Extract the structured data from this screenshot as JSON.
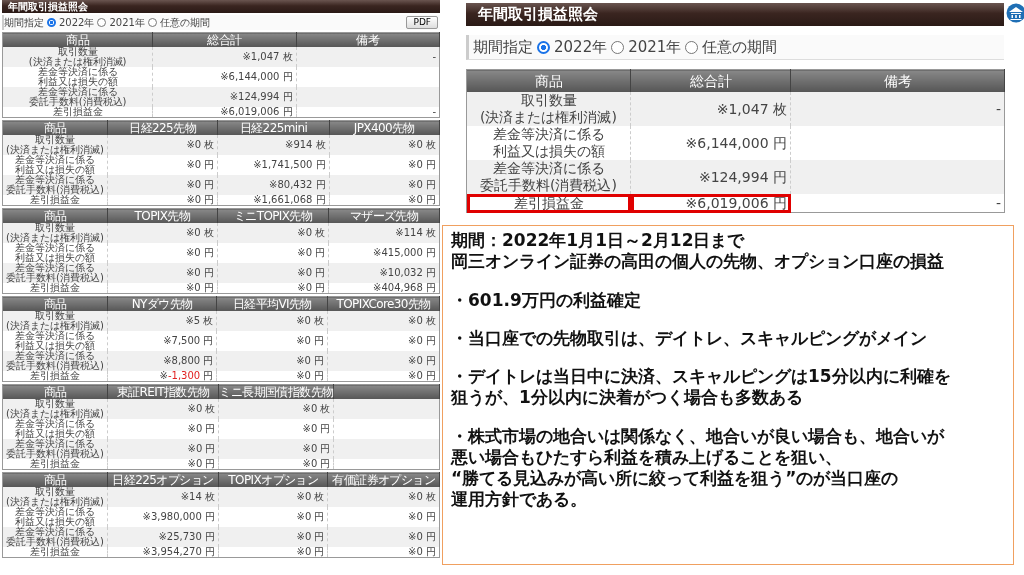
{
  "left_panel": {
    "title": "年間取引損益照会",
    "period_label": "期間指定",
    "period_options": [
      {
        "label": "2022年",
        "selected": true
      },
      {
        "label": "2021年",
        "selected": false
      },
      {
        "label": "任意の期間",
        "selected": false
      }
    ],
    "pdf_button": "PDF",
    "tables": [
      {
        "columns": [
          "商品",
          "総合計",
          "備考"
        ],
        "rows": [
          {
            "cells": [
              {
                "kind": "label",
                "lines": [
                  "取引数量",
                  "(決済または権利消滅)"
                ]
              },
              {
                "kind": "amount",
                "mark": "※",
                "amount": "1,047",
                "unit": "枚",
                "negative": false
              },
              {
                "kind": "text",
                "text": "-"
              }
            ]
          },
          {
            "cells": [
              {
                "kind": "label",
                "lines": [
                  "差金等決済に係る",
                  "利益又は損失の額"
                ]
              },
              {
                "kind": "amount",
                "mark": "※",
                "amount": "6,144,000",
                "unit": "円",
                "negative": false
              },
              null
            ]
          },
          {
            "cells": [
              {
                "kind": "label",
                "lines": [
                  "差金等決済に係る",
                  "委託手数料(消費税込)"
                ]
              },
              {
                "kind": "amount",
                "mark": "※",
                "amount": "124,994",
                "unit": "円",
                "negative": false
              },
              null
            ]
          },
          {
            "cells": [
              {
                "kind": "label",
                "lines": [
                  "差引損益金"
                ]
              },
              {
                "kind": "amount",
                "mark": "※",
                "amount": "6,019,006",
                "unit": "円",
                "negative": false
              },
              {
                "kind": "text",
                "text": "-"
              }
            ]
          }
        ]
      },
      {
        "columns": [
          "商品",
          "日経225先物",
          "日経225mini",
          "JPX400先物"
        ],
        "rows": [
          {
            "cells": [
              {
                "kind": "label",
                "lines": [
                  "取引数量",
                  "(決済または権利消滅)"
                ]
              },
              {
                "kind": "amount",
                "mark": "※",
                "amount": "0",
                "unit": "枚",
                "negative": false
              },
              {
                "kind": "amount",
                "mark": "※",
                "amount": "914",
                "unit": "枚",
                "negative": false
              },
              {
                "kind": "amount",
                "mark": "※",
                "amount": "0",
                "unit": "枚",
                "negative": false
              }
            ]
          },
          {
            "cells": [
              {
                "kind": "label",
                "lines": [
                  "差金等決済に係る",
                  "利益又は損失の額"
                ]
              },
              {
                "kind": "amount",
                "mark": "※",
                "amount": "0",
                "unit": "円",
                "negative": false
              },
              {
                "kind": "amount",
                "mark": "※",
                "amount": "1,741,500",
                "unit": "円",
                "negative": false
              },
              {
                "kind": "amount",
                "mark": "※",
                "amount": "0",
                "unit": "円",
                "negative": false
              }
            ]
          },
          {
            "cells": [
              {
                "kind": "label",
                "lines": [
                  "差金等決済に係る",
                  "委託手数料(消費税込)"
                ]
              },
              {
                "kind": "amount",
                "mark": "※",
                "amount": "0",
                "unit": "円",
                "negative": false
              },
              {
                "kind": "amount",
                "mark": "※",
                "amount": "80,432",
                "unit": "円",
                "negative": false
              },
              {
                "kind": "amount",
                "mark": "※",
                "amount": "0",
                "unit": "円",
                "negative": false
              }
            ]
          },
          {
            "cells": [
              {
                "kind": "label",
                "lines": [
                  "差引損益金"
                ]
              },
              {
                "kind": "amount",
                "mark": "※",
                "amount": "0",
                "unit": "円",
                "negative": false
              },
              {
                "kind": "amount",
                "mark": "※",
                "amount": "1,661,068",
                "unit": "円",
                "negative": false
              },
              {
                "kind": "amount",
                "mark": "※",
                "amount": "0",
                "unit": "円",
                "negative": false
              }
            ]
          }
        ]
      },
      {
        "columns": [
          "商品",
          "TOPIX先物",
          "ミニTOPIX先物",
          "マザーズ先物"
        ],
        "rows": [
          {
            "cells": [
              {
                "kind": "label",
                "lines": [
                  "取引数量",
                  "(決済または権利消滅)"
                ]
              },
              {
                "kind": "amount",
                "mark": "※",
                "amount": "0",
                "unit": "枚",
                "negative": false
              },
              {
                "kind": "amount",
                "mark": "※",
                "amount": "0",
                "unit": "枚",
                "negative": false
              },
              {
                "kind": "amount",
                "mark": "※",
                "amount": "114",
                "unit": "枚",
                "negative": false
              }
            ]
          },
          {
            "cells": [
              {
                "kind": "label",
                "lines": [
                  "差金等決済に係る",
                  "利益又は損失の額"
                ]
              },
              {
                "kind": "amount",
                "mark": "※",
                "amount": "0",
                "unit": "円",
                "negative": false
              },
              {
                "kind": "amount",
                "mark": "※",
                "amount": "0",
                "unit": "円",
                "negative": false
              },
              {
                "kind": "amount",
                "mark": "※",
                "amount": "415,000",
                "unit": "円",
                "negative": false
              }
            ]
          },
          {
            "cells": [
              {
                "kind": "label",
                "lines": [
                  "差金等決済に係る",
                  "委託手数料(消費税込)"
                ]
              },
              {
                "kind": "amount",
                "mark": "※",
                "amount": "0",
                "unit": "円",
                "negative": false
              },
              {
                "kind": "amount",
                "mark": "※",
                "amount": "0",
                "unit": "円",
                "negative": false
              },
              {
                "kind": "amount",
                "mark": "※",
                "amount": "10,032",
                "unit": "円",
                "negative": false
              }
            ]
          },
          {
            "cells": [
              {
                "kind": "label",
                "lines": [
                  "差引損益金"
                ]
              },
              {
                "kind": "amount",
                "mark": "※",
                "amount": "0",
                "unit": "円",
                "negative": false
              },
              {
                "kind": "amount",
                "mark": "※",
                "amount": "0",
                "unit": "円",
                "negative": false
              },
              {
                "kind": "amount",
                "mark": "※",
                "amount": "404,968",
                "unit": "円",
                "negative": false
              }
            ]
          }
        ]
      },
      {
        "columns": [
          "商品",
          "NYダウ先物",
          "日経平均VI先物",
          "TOPIXCore30先物"
        ],
        "rows": [
          {
            "cells": [
              {
                "kind": "label",
                "lines": [
                  "取引数量",
                  "(決済または権利消滅)"
                ]
              },
              {
                "kind": "amount",
                "mark": "※",
                "amount": "5",
                "unit": "枚",
                "negative": false
              },
              {
                "kind": "amount",
                "mark": "※",
                "amount": "0",
                "unit": "枚",
                "negative": false
              },
              {
                "kind": "amount",
                "mark": "※",
                "amount": "0",
                "unit": "枚",
                "negative": false
              }
            ]
          },
          {
            "cells": [
              {
                "kind": "label",
                "lines": [
                  "差金等決済に係る",
                  "利益又は損失の額"
                ]
              },
              {
                "kind": "amount",
                "mark": "※",
                "amount": "7,500",
                "unit": "円",
                "negative": false
              },
              {
                "kind": "amount",
                "mark": "※",
                "amount": "0",
                "unit": "円",
                "negative": false
              },
              {
                "kind": "amount",
                "mark": "※",
                "amount": "0",
                "unit": "円",
                "negative": false
              }
            ]
          },
          {
            "cells": [
              {
                "kind": "label",
                "lines": [
                  "差金等決済に係る",
                  "委託手数料(消費税込)"
                ]
              },
              {
                "kind": "amount",
                "mark": "※",
                "amount": "8,800",
                "unit": "円",
                "negative": false
              },
              {
                "kind": "amount",
                "mark": "※",
                "amount": "0",
                "unit": "円",
                "negative": false
              },
              {
                "kind": "amount",
                "mark": "※",
                "amount": "0",
                "unit": "円",
                "negative": false
              }
            ]
          },
          {
            "cells": [
              {
                "kind": "label",
                "lines": [
                  "差引損益金"
                ]
              },
              {
                "kind": "amount",
                "mark": "※",
                "amount": "-1,300",
                "unit": "円",
                "negative": true
              },
              {
                "kind": "amount",
                "mark": "※",
                "amount": "0",
                "unit": "円",
                "negative": false
              },
              {
                "kind": "amount",
                "mark": "※",
                "amount": "0",
                "unit": "円",
                "negative": false
              }
            ]
          }
        ]
      },
      {
        "columns": [
          "商品",
          "東証REIT指数先物",
          "ミニ長期国債指数先物",
          null
        ],
        "rows": [
          {
            "cells": [
              {
                "kind": "label",
                "lines": [
                  "取引数量",
                  "(決済または権利消滅)"
                ]
              },
              {
                "kind": "amount",
                "mark": "※",
                "amount": "0",
                "unit": "枚",
                "negative": false
              },
              {
                "kind": "amount",
                "mark": "※",
                "amount": "0",
                "unit": "枚",
                "negative": false
              },
              null
            ]
          },
          {
            "cells": [
              {
                "kind": "label",
                "lines": [
                  "差金等決済に係る",
                  "利益又は損失の額"
                ]
              },
              {
                "kind": "amount",
                "mark": "※",
                "amount": "0",
                "unit": "円",
                "negative": false
              },
              {
                "kind": "amount",
                "mark": "※",
                "amount": "0",
                "unit": "円",
                "negative": false
              },
              null
            ]
          },
          {
            "cells": [
              {
                "kind": "label",
                "lines": [
                  "差金等決済に係る",
                  "委託手数料(消費税込)"
                ]
              },
              {
                "kind": "amount",
                "mark": "※",
                "amount": "0",
                "unit": "円",
                "negative": false
              },
              {
                "kind": "amount",
                "mark": "※",
                "amount": "0",
                "unit": "円",
                "negative": false
              },
              null
            ]
          },
          {
            "cells": [
              {
                "kind": "label",
                "lines": [
                  "差引損益金"
                ]
              },
              {
                "kind": "amount",
                "mark": "※",
                "amount": "0",
                "unit": "円",
                "negative": false
              },
              {
                "kind": "amount",
                "mark": "※",
                "amount": "0",
                "unit": "円",
                "negative": false
              },
              null
            ]
          }
        ]
      },
      {
        "columns": [
          "商品",
          "日経225オプション",
          "TOPIXオプション",
          "有価証券オプション"
        ],
        "rows": [
          {
            "cells": [
              {
                "kind": "label",
                "lines": [
                  "取引数量",
                  "(決済または権利消滅)"
                ]
              },
              {
                "kind": "amount",
                "mark": "※",
                "amount": "14",
                "unit": "枚",
                "negative": false
              },
              {
                "kind": "amount",
                "mark": "※",
                "amount": "0",
                "unit": "枚",
                "negative": false
              },
              {
                "kind": "amount",
                "mark": "※",
                "amount": "0",
                "unit": "枚",
                "negative": false
              }
            ]
          },
          {
            "cells": [
              {
                "kind": "label",
                "lines": [
                  "差金等決済に係る",
                  "利益又は損失の額"
                ]
              },
              {
                "kind": "amount",
                "mark": "※",
                "amount": "3,980,000",
                "unit": "円",
                "negative": false
              },
              {
                "kind": "amount",
                "mark": "※",
                "amount": "0",
                "unit": "円",
                "negative": false
              },
              {
                "kind": "amount",
                "mark": "※",
                "amount": "0",
                "unit": "円",
                "negative": false
              }
            ]
          },
          {
            "cells": [
              {
                "kind": "label",
                "lines": [
                  "差金等決済に係る",
                  "委託手数料(消費税込)"
                ]
              },
              {
                "kind": "amount",
                "mark": "※",
                "amount": "25,730",
                "unit": "円",
                "negative": false
              },
              {
                "kind": "amount",
                "mark": "※",
                "amount": "0",
                "unit": "円",
                "negative": false
              },
              {
                "kind": "amount",
                "mark": "※",
                "amount": "0",
                "unit": "円",
                "negative": false
              }
            ]
          },
          {
            "cells": [
              {
                "kind": "label",
                "lines": [
                  "差引損益金"
                ]
              },
              {
                "kind": "amount",
                "mark": "※",
                "amount": "3,954,270",
                "unit": "円",
                "negative": false
              },
              {
                "kind": "amount",
                "mark": "※",
                "amount": "0",
                "unit": "円",
                "negative": false
              },
              {
                "kind": "amount",
                "mark": "※",
                "amount": "0",
                "unit": "円",
                "negative": false
              }
            ]
          }
        ]
      }
    ]
  },
  "zoom_panel": {
    "title": "年間取引損益照会",
    "period_label": "期間指定",
    "period_options": [
      {
        "label": "2022年",
        "selected": true
      },
      {
        "label": "2021年",
        "selected": false
      },
      {
        "label": "任意の期間",
        "selected": false
      }
    ],
    "table": {
      "columns": [
        "商品",
        "総合計",
        "備考"
      ],
      "rows": [
        {
          "highlighted": false,
          "cells": [
            {
              "kind": "label",
              "lines": [
                "取引数量",
                "(決済または権利消滅)"
              ]
            },
            {
              "kind": "amount",
              "mark": "※",
              "amount": "1,047",
              "unit": "枚",
              "negative": false
            },
            {
              "kind": "text",
              "text": "-"
            }
          ]
        },
        {
          "highlighted": false,
          "cells": [
            {
              "kind": "label",
              "lines": [
                "差金等決済に係る",
                "利益又は損失の額"
              ]
            },
            {
              "kind": "amount",
              "mark": "※",
              "amount": "6,144,000",
              "unit": "円",
              "negative": false
            },
            null
          ]
        },
        {
          "highlighted": false,
          "cells": [
            {
              "kind": "label",
              "lines": [
                "差金等決済に係る",
                "委託手数料(消費税込)"
              ]
            },
            {
              "kind": "amount",
              "mark": "※",
              "amount": "124,994",
              "unit": "円",
              "negative": false
            },
            null
          ]
        },
        {
          "highlighted": true,
          "cells": [
            {
              "kind": "label",
              "lines": [
                "差引損益金"
              ]
            },
            {
              "kind": "amount",
              "mark": "※",
              "amount": "6,019,006",
              "unit": "円",
              "negative": false
            },
            {
              "kind": "text",
              "text": "-"
            }
          ]
        }
      ]
    }
  },
  "notes": [
    {
      "lines": [
        "期間：2022年1月1日～2月12日まで",
        "岡三オンライン証券の高田の個人の先物、オプション口座の損益"
      ]
    },
    {
      "lines": [
        "・601.9万円の利益確定"
      ]
    },
    {
      "lines": [
        "・当口座での先物取引は、デイトレ、スキャルピングがメイン"
      ]
    },
    {
      "lines": [
        "・デイトレは当日中に決済、スキャルピングは15分以内に利確を",
        "狙うが、1分以内に決着がつく場合も多数ある"
      ]
    },
    {
      "lines": [
        "・株式市場の地合いは関係なく、地合いが良い場合も、地合いが",
        "悪い場合もひたすら利益を積み上げることを狙い、",
        "“勝てる見込みが高い所に絞って利益を狙う”のが当口座の",
        "運用方針である。"
      ]
    }
  ]
}
